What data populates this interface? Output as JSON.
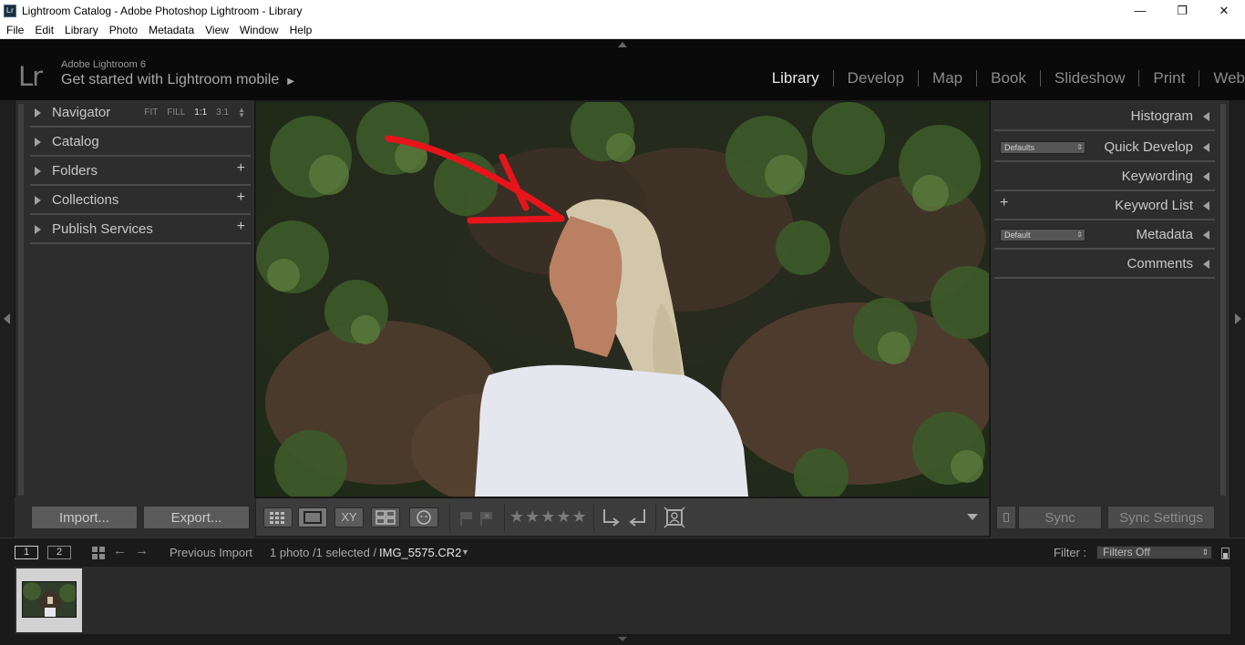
{
  "window": {
    "title": "Lightroom Catalog - Adobe Photoshop Lightroom - Library",
    "app_icon": "Lr",
    "minimize": "—",
    "restore": "❐",
    "close": "✕"
  },
  "menubar": [
    "File",
    "Edit",
    "Library",
    "Photo",
    "Metadata",
    "View",
    "Window",
    "Help"
  ],
  "identity": {
    "logo": "Lr",
    "version": "Adobe Lightroom 6",
    "mobile": "Get started with Lightroom mobile",
    "mobile_arrow": "▶"
  },
  "modules": [
    "Library",
    "Develop",
    "Map",
    "Book",
    "Slideshow",
    "Print",
    "Web"
  ],
  "active_module": "Library",
  "left_panel": {
    "navigator": {
      "label": "Navigator",
      "zoom": [
        "FIT",
        "FILL",
        "1:1",
        "3:1"
      ],
      "selected_zoom": "1:1"
    },
    "catalog": "Catalog",
    "folders": "Folders",
    "collections": "Collections",
    "publish": "Publish Services",
    "plus": "+"
  },
  "left_bottom": {
    "import": "Import...",
    "export": "Export..."
  },
  "right_panel": {
    "histogram": "Histogram",
    "quick_develop": "Quick Develop",
    "quick_develop_preset": "Defaults",
    "keywording": "Keywording",
    "keyword_list": "Keyword List",
    "keyword_plus": "+",
    "metadata": "Metadata",
    "metadata_preset": "Default",
    "comments": "Comments"
  },
  "right_bottom": {
    "sync": "Sync",
    "sync_settings": "Sync Settings"
  },
  "toolbar": {
    "xy_label": "XY",
    "stars": "★★★★★"
  },
  "film_header": {
    "view1": "1",
    "view2": "2",
    "source": "Previous Import",
    "count": "1 photo /1 selected /",
    "filename": "IMG_5575.CR2",
    "filter_label": "Filter :",
    "filter_value": "Filters Off"
  },
  "colors": {
    "annotation_arrow": "#e8141b",
    "panel_bg": "#2d2d2d",
    "active_module": "#e6e6e6"
  }
}
